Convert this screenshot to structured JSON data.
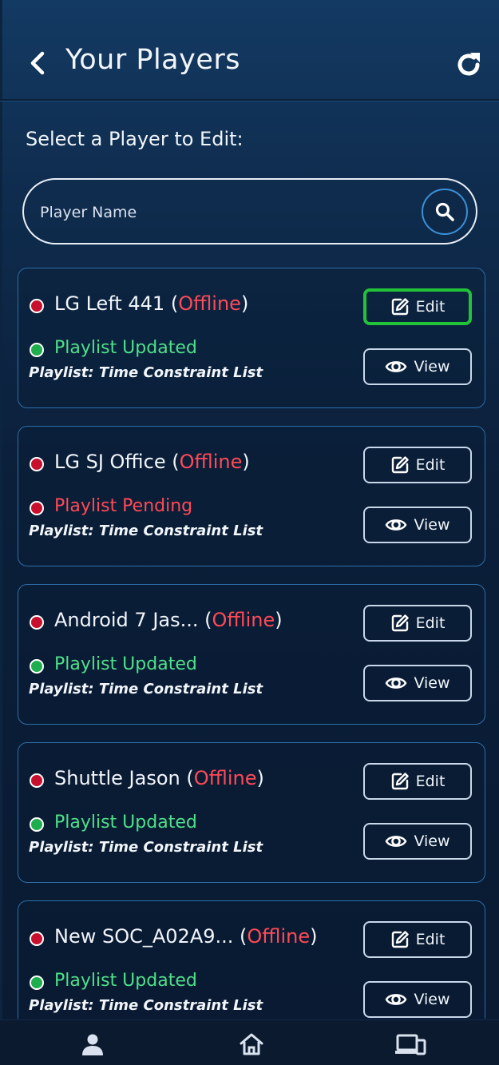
{
  "header": {
    "title": "Your Players"
  },
  "subtitle": "Select a Player to Edit:",
  "search": {
    "placeholder": "Player Name"
  },
  "buttons": {
    "edit": "Edit",
    "view": "View"
  },
  "offline_word": "Offline",
  "players": [
    {
      "name": "LG Left 441",
      "connection": "Offline",
      "status": "Playlist Updated",
      "playlist_label": "Playlist:",
      "playlist_name": "Time Constraint List"
    },
    {
      "name": "LG SJ Office",
      "connection": "Offline",
      "status": "Playlist Pending",
      "playlist_label": "Playlist:",
      "playlist_name": "Time Constraint List"
    },
    {
      "name": "Android 7 Jas...",
      "connection": "Offline",
      "status": "Playlist Updated",
      "playlist_label": "Playlist:",
      "playlist_name": "Time Constraint List"
    },
    {
      "name": "Shuttle Jason",
      "connection": "Offline",
      "status": "Playlist Updated",
      "playlist_label": "Playlist:",
      "playlist_name": "Time Constraint List"
    },
    {
      "name": "New SOC_A02A9...",
      "connection": "Offline",
      "status": "Playlist Updated",
      "playlist_label": "Playlist:",
      "playlist_name": "Time Constraint List"
    }
  ],
  "colors": {
    "offline": "#ff4a57",
    "updated": "#4ee08a",
    "pending": "#ff4a57",
    "active_border": "#22c338",
    "card_border": "#2d6ea8"
  },
  "icons": {
    "back": "chevron-left-icon",
    "refresh": "refresh-icon",
    "search": "search-icon",
    "edit": "edit-icon",
    "view": "eye-icon",
    "nav": [
      "user-icon",
      "home-icon",
      "devices-icon"
    ]
  }
}
